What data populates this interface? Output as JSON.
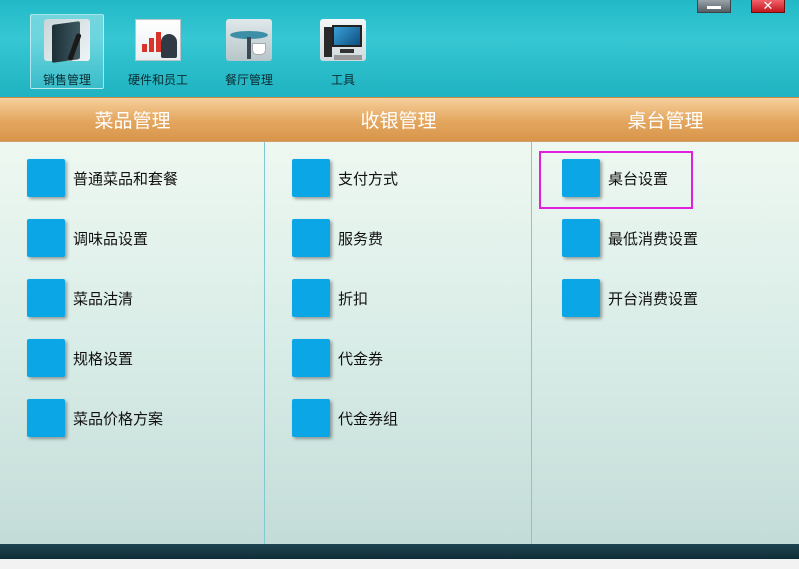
{
  "window": {
    "minimize_label": "",
    "close_label": "✕"
  },
  "toolbar": [
    {
      "label": "销售管理",
      "icon": "sales-book-icon",
      "active": true
    },
    {
      "label": "硬件和员工",
      "icon": "chart-person-icon",
      "active": false
    },
    {
      "label": "餐厅管理",
      "icon": "cafe-table-icon",
      "active": false
    },
    {
      "label": "工具",
      "icon": "computer-icon",
      "active": false
    }
  ],
  "sections": [
    {
      "title": "菜品管理",
      "items": [
        "普通菜品和套餐",
        "调味品设置",
        "菜品沽清",
        "规格设置",
        "菜品价格方案"
      ]
    },
    {
      "title": "收银管理",
      "items": [
        "支付方式",
        "服务费",
        "折扣",
        "代金券",
        "代金券组"
      ]
    },
    {
      "title": "桌台管理",
      "items": [
        "桌台设置",
        "最低消费设置",
        "开台消费设置"
      ]
    }
  ],
  "colors": {
    "tile": "#0aa6e6",
    "highlight": "#e01fe0",
    "header_band": "#e3a65e",
    "toolbar": "#22b9c7"
  }
}
